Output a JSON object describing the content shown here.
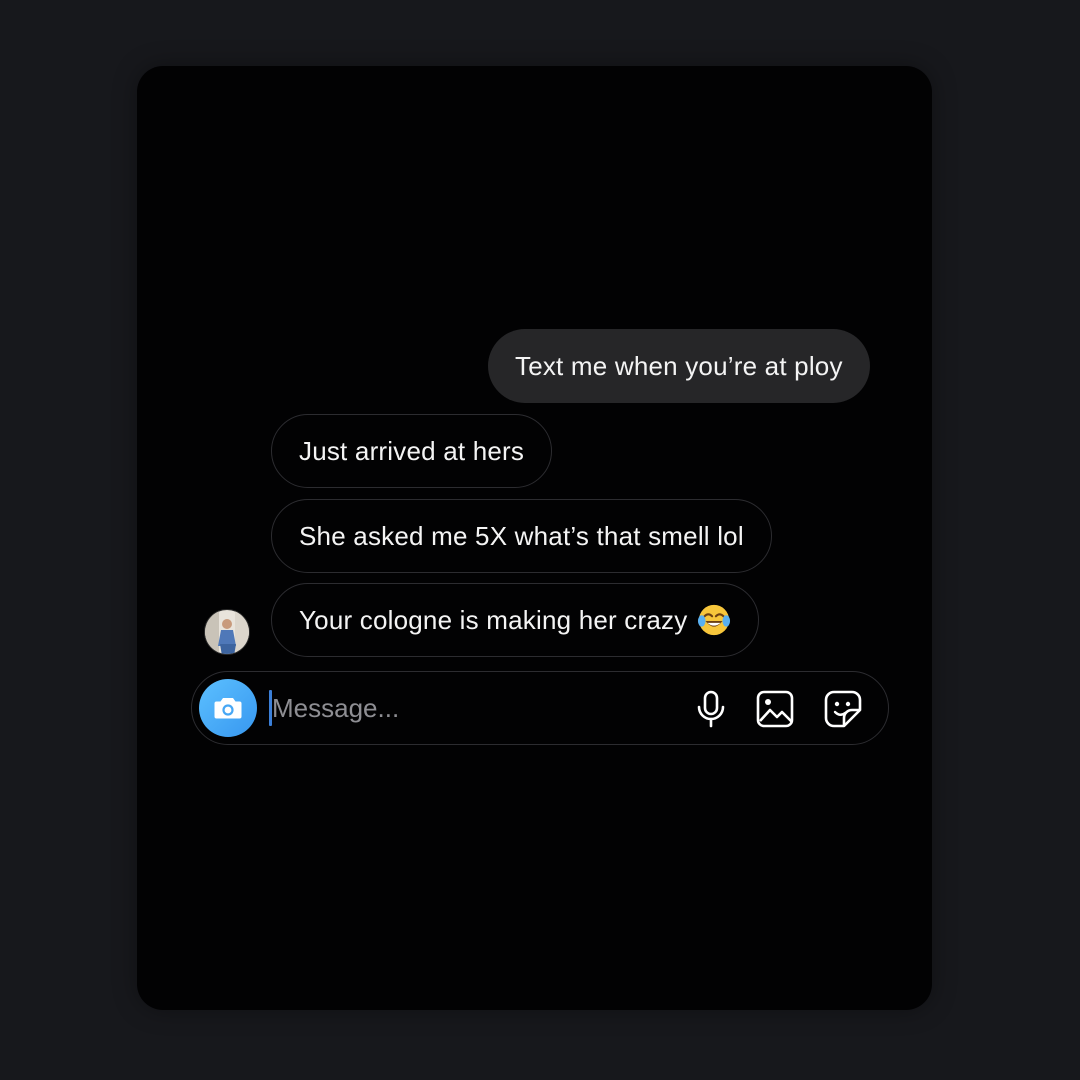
{
  "thread": {
    "outgoing": [
      {
        "text": "Text me when you’re at ploy"
      }
    ],
    "incoming": [
      {
        "text": "Just arrived at hers"
      },
      {
        "text": "She asked me 5X what’s that smell lol"
      },
      {
        "text": "Your cologne is making her crazy",
        "emoji": "face-with-tears-of-joy"
      }
    ],
    "avatar": "contact-avatar"
  },
  "composer": {
    "placeholder": "Message...",
    "value": "",
    "camera_icon": "camera-icon",
    "tools": [
      "microphone-icon",
      "gallery-icon",
      "sticker-icon"
    ]
  },
  "colors": {
    "background": "#17181c",
    "card": "#020203",
    "outgoing_bubble": "#262628",
    "incoming_border": "#2c2c30",
    "camera_gradient_start": "#5cc0ff",
    "camera_gradient_end": "#3797f0",
    "caret": "#3b7fd8",
    "placeholder": "#8e8e93"
  }
}
